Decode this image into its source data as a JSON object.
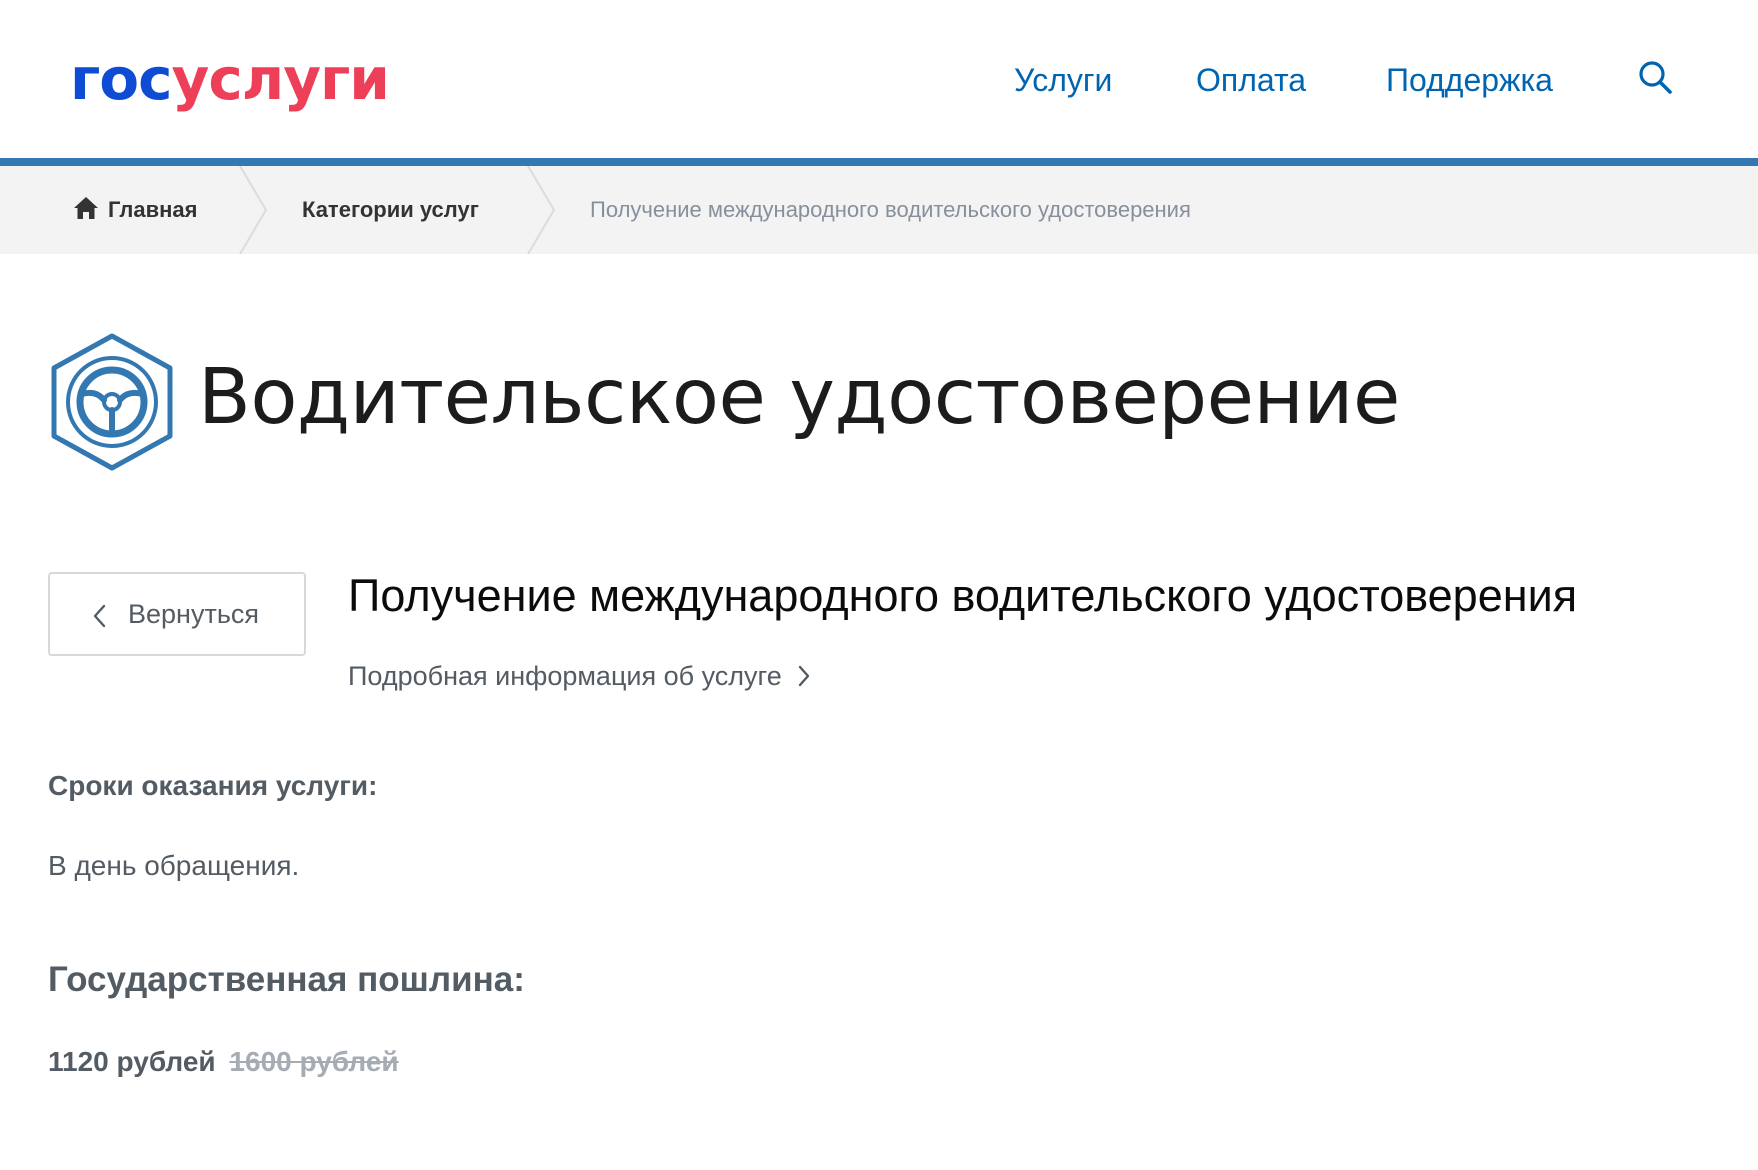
{
  "header": {
    "logo": {
      "part1": "гос",
      "part2": "услуги"
    },
    "nav": [
      {
        "label": "Услуги"
      },
      {
        "label": "Оплата"
      },
      {
        "label": "Поддержка"
      }
    ],
    "search_icon": "search-icon"
  },
  "breadcrumbs": {
    "home": "Главная",
    "categories": "Категории услуг",
    "current": "Получение международного водительского удостоверения"
  },
  "page": {
    "title": "Водительское удостоверение",
    "icon": "steering-wheel-icon"
  },
  "service": {
    "back_label": "Вернуться",
    "title": "Получение международного водительского удостоверения",
    "more_info": "Подробная информация об услуге"
  },
  "details": {
    "terms_label": "Сроки оказания услуги:",
    "terms_value": "В день обращения.",
    "fee_label": "Государственная пошлина:",
    "fee_new": "1120 рублей",
    "fee_old": "1600 рублей"
  },
  "colors": {
    "brand_blue": "#0d4cd3",
    "brand_red": "#ee3f58",
    "link_blue": "#0065b1",
    "accent_line": "#3378b1"
  }
}
